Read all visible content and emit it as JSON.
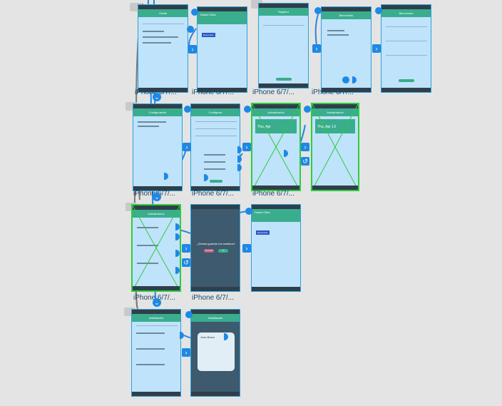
{
  "canvas_bg": "#e4e4e4",
  "accent": "#1e88e5",
  "captions": {
    "c1": "iPhone 6/7/...",
    "c2": "iPhone 6/7/...",
    "c3": "iPhone 6/7/...",
    "c4": "iPhone 6/7/...",
    "c5": "iPhone 6/7/...",
    "c6": "iPhone 6/7/...",
    "c7": "iPhone 6/7/...",
    "c8": "iPhone 6/7/...",
    "c9": "iPhone 6/7/..."
  },
  "screens": {
    "s1_title": "Olvidé",
    "s2_name": "Daniel Oliva",
    "s2_badge": "Reservado",
    "s3_title": "Registro",
    "s4_title": "Bienvenido",
    "s5_title": "Bienvenido",
    "s6_title": "Configuración",
    "s7_title": "Configurar",
    "s8_title": "Actualización",
    "s8_date": "Thu, Apr",
    "s9_title": "Actualización",
    "s9_date": "Thu, Apr 13",
    "s10_title": "Actualización",
    "s11_question": "¿Desea guardar los cambios?",
    "s11_no": "Cancelar",
    "s11_yes": "Sí",
    "s12_name": "Daniel Oliva",
    "s12_badge": "Reservado",
    "s13_title": "Habilitación",
    "s14_title": "Habilitación",
    "s14_dialog": "Juan Bravo"
  },
  "icons": [
    "chevron-right-icon",
    "chevron-down-icon",
    "undo-icon"
  ]
}
